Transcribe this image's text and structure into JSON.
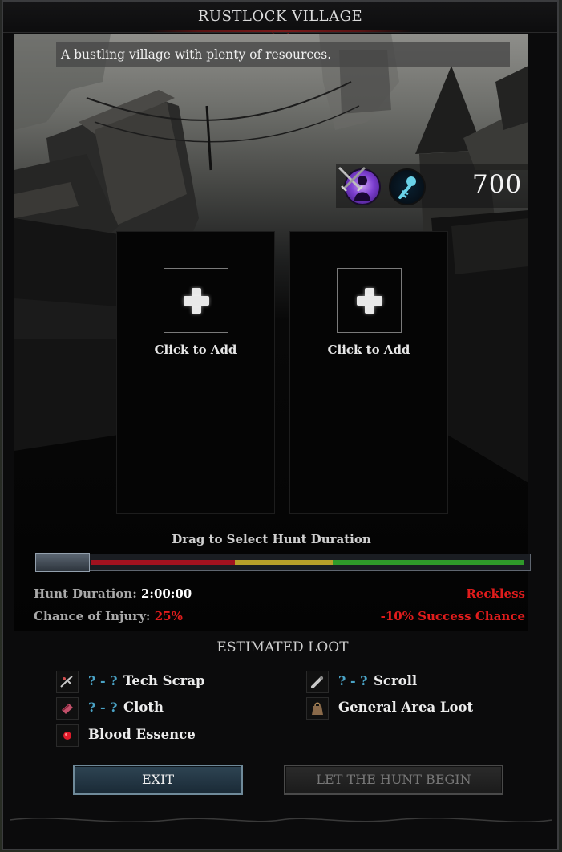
{
  "window": {
    "title": "RUSTLOCK VILLAGE"
  },
  "location": {
    "description": "A bustling village with plenty of resources."
  },
  "party_stats": {
    "icons": [
      "purple-silhouette-icon",
      "blue-serpent-icon",
      "crossed-swords-icon"
    ],
    "power": "700"
  },
  "slots": [
    {
      "label": "Click to Add",
      "icon": "plus-icon"
    },
    {
      "label": "Click to Add",
      "icon": "plus-icon"
    }
  ],
  "duration_slider": {
    "label": "Drag to Select Hunt Duration",
    "segment_colors": {
      "danger": "#a0121f",
      "risky": "#b7a02a",
      "safe": "#2f9a2a"
    }
  },
  "hunt_info": {
    "duration_label": "Hunt Duration:",
    "duration_value": "2:00:00",
    "injury_label": "Chance of Injury:",
    "injury_value": "25%",
    "risk_level": "Reckless",
    "success_modifier": "-10% Success Chance"
  },
  "loot": {
    "title": "ESTIMATED LOOT",
    "items": [
      {
        "range": "? - ?",
        "name": "Tech Scrap",
        "icon": "tech-scrap-icon"
      },
      {
        "range": "? - ?",
        "name": "Cloth",
        "icon": "cloth-icon"
      },
      {
        "range": "",
        "name": "Blood Essence",
        "icon": "blood-essence-icon"
      },
      {
        "range": "? - ?",
        "name": "Scroll",
        "icon": "scroll-icon"
      },
      {
        "range": "",
        "name": "General Area Loot",
        "icon": "bag-icon"
      }
    ]
  },
  "buttons": {
    "exit": "EXIT",
    "begin": "LET THE HUNT BEGIN"
  },
  "colors": {
    "accent_red": "#e01c1c",
    "loot_range_blue": "#4aa3c6",
    "exit_button": "#2e4453"
  }
}
